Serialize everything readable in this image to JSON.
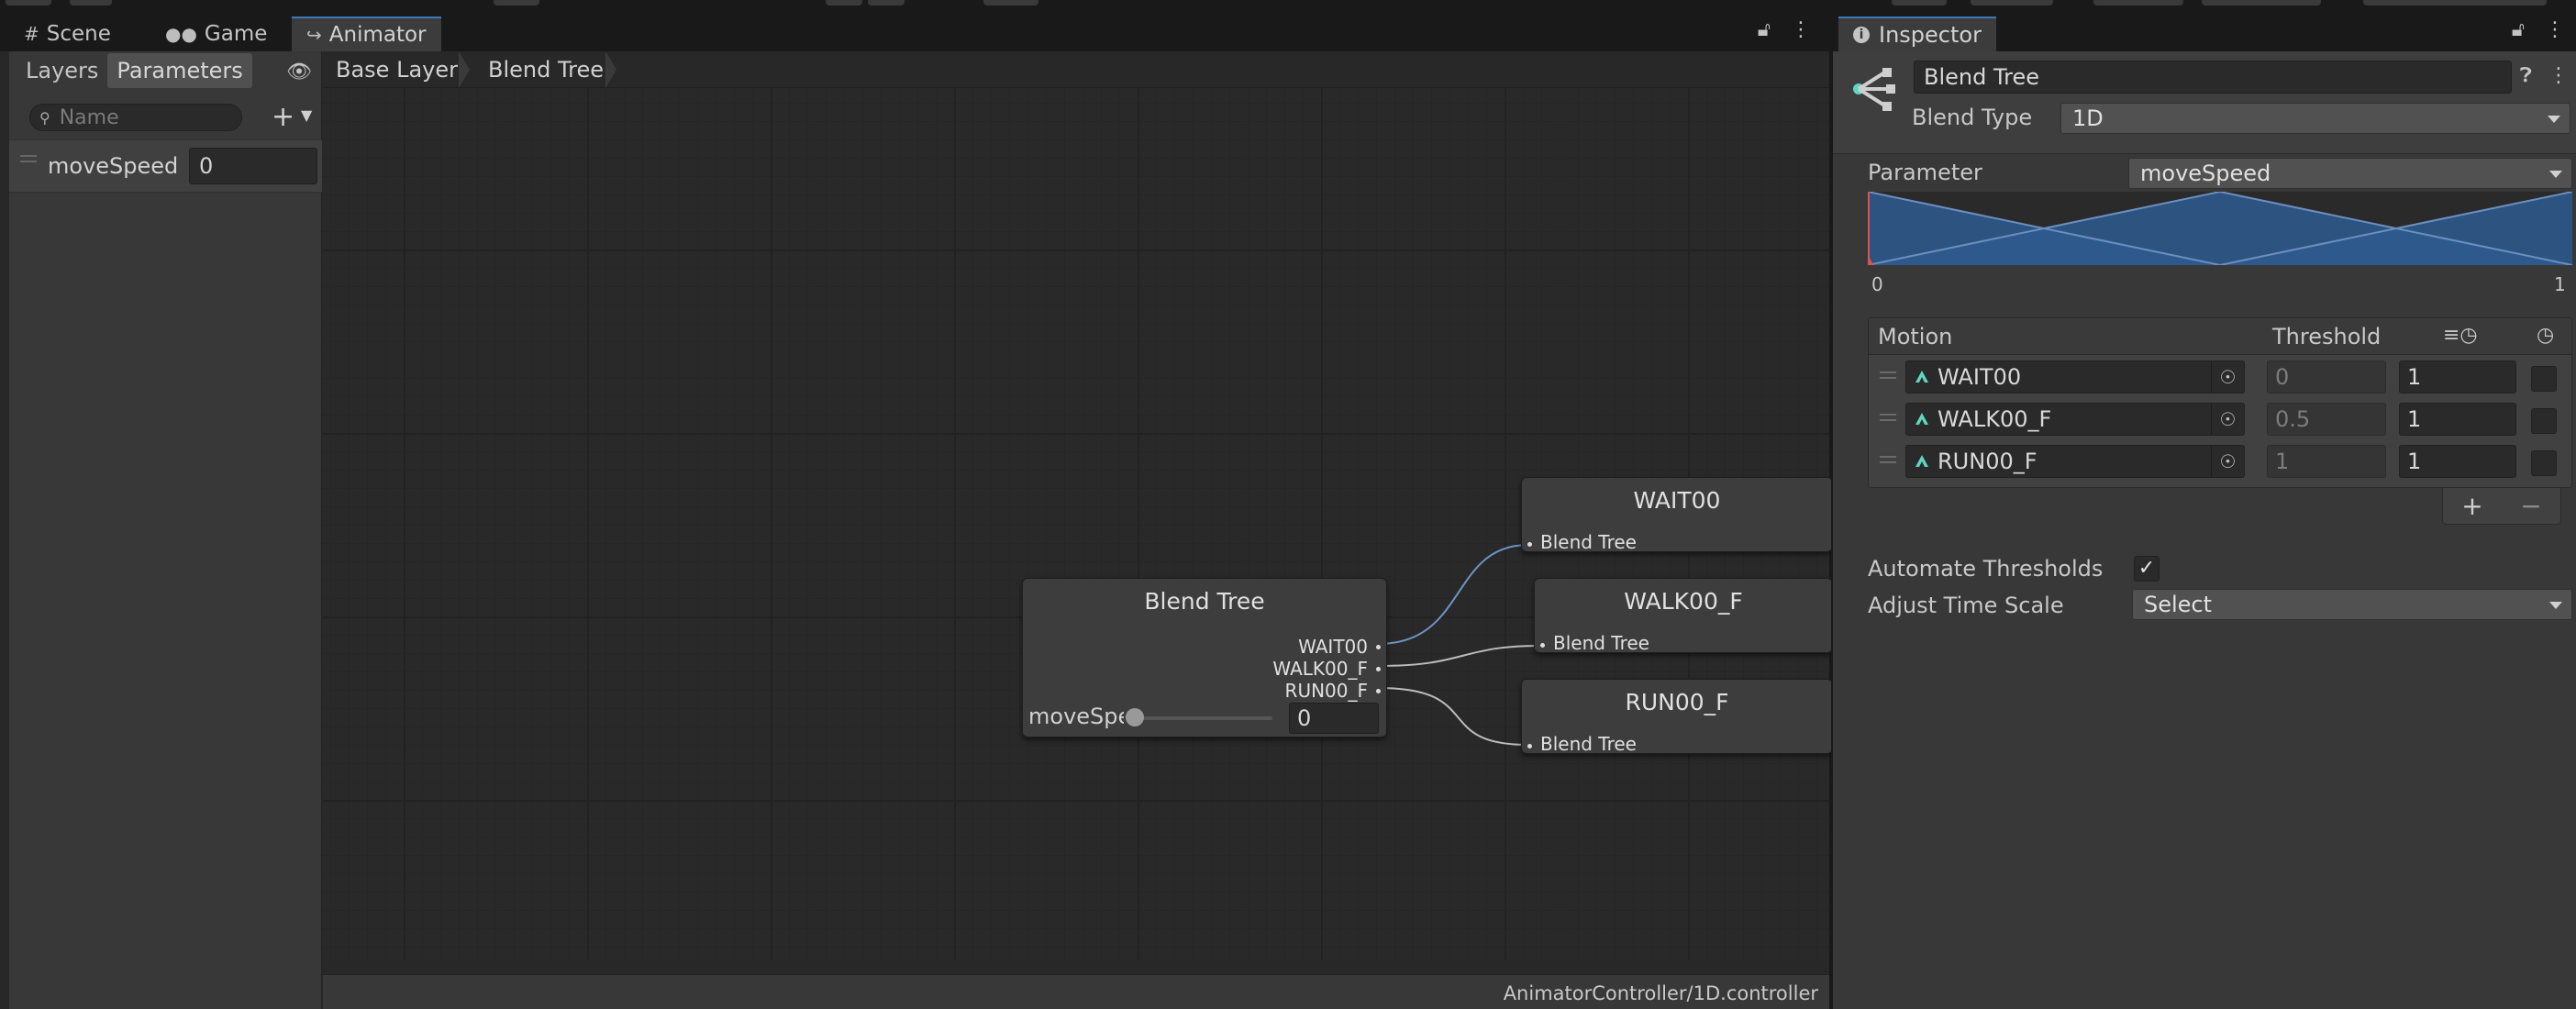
{
  "animator": {
    "tabs": [
      {
        "label": "Scene",
        "icon": "grid-icon"
      },
      {
        "label": "Game",
        "icon": "gamepad-icon"
      },
      {
        "label": "Animator",
        "icon": "animator-icon"
      }
    ],
    "left_tabs": [
      "Layers",
      "Parameters"
    ],
    "search_placeholder": "Name",
    "parameters": [
      {
        "name": "moveSpeed",
        "value": "0"
      }
    ],
    "breadcrumb": [
      "Base Layer",
      "Blend Tree"
    ],
    "status_path": "AnimatorController/1D.controller",
    "blend_node": {
      "title": "Blend Tree",
      "outputs": [
        "WAIT00",
        "WALK00_F",
        "RUN00_F"
      ],
      "param_label": "moveSpeed",
      "param_value": "0",
      "slider_fraction": 0
    },
    "child_nodes": [
      {
        "title": "WAIT00",
        "port": "Blend Tree"
      },
      {
        "title": "WALK00_F",
        "port": "Blend Tree"
      },
      {
        "title": "RUN00_F",
        "port": "Blend Tree"
      }
    ]
  },
  "inspector": {
    "tab_label": "Inspector",
    "name": "Blend Tree",
    "blend_type_label": "Blend Type",
    "blend_type_value": "1D",
    "parameter_label": "Parameter",
    "parameter_value": "moveSpeed",
    "axis_min": "0",
    "axis_max": "1",
    "list_headers": {
      "motion": "Motion",
      "threshold": "Threshold"
    },
    "motions": [
      {
        "clip": "WAIT00",
        "threshold": "0",
        "time_scale": "1",
        "mirror": false
      },
      {
        "clip": "WALK00_F",
        "threshold": "0.5",
        "time_scale": "1",
        "mirror": false
      },
      {
        "clip": "RUN00_F",
        "threshold": "1",
        "time_scale": "1",
        "mirror": false
      }
    ],
    "automate_label": "Automate Thresholds",
    "automate_checked": true,
    "adjust_label": "Adjust Time Scale",
    "adjust_value": "Select"
  },
  "colors": {
    "accent_tab": "#3a79bb",
    "blend_fill": "#2e5a8f",
    "clip_icon": "#5fd6c2",
    "marker_red": "#d9534f"
  }
}
